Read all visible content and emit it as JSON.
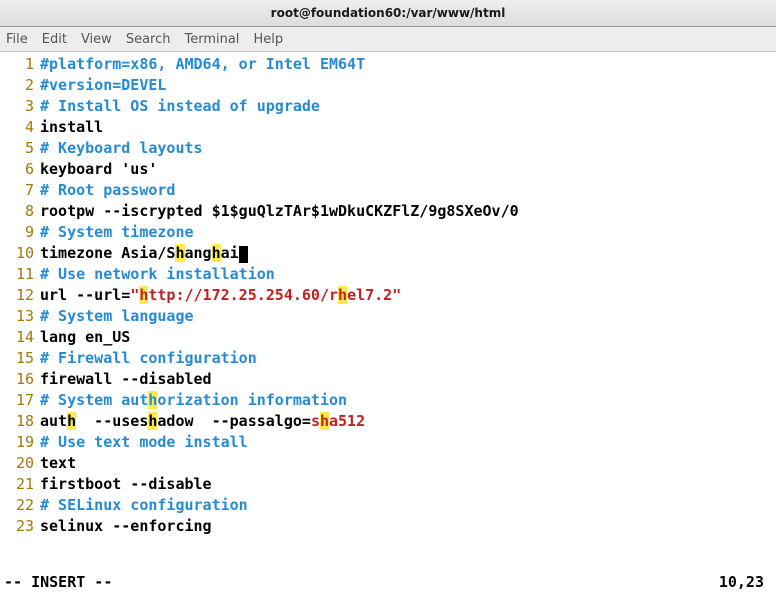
{
  "window": {
    "title": "root@foundation60:/var/www/html"
  },
  "menubar": {
    "items": [
      "File",
      "Edit",
      "View",
      "Search",
      "Terminal",
      "Help"
    ]
  },
  "editor": {
    "lines": [
      {
        "n": 1,
        "tokens": [
          {
            "t": "#platform=x86, AMD64, or Intel EM64T",
            "cls": "c-comment"
          }
        ]
      },
      {
        "n": 2,
        "tokens": [
          {
            "t": "#version=DEVEL",
            "cls": "c-comment"
          }
        ]
      },
      {
        "n": 3,
        "tokens": [
          {
            "t": "# Install OS instead of upgrade",
            "cls": "c-comment"
          }
        ]
      },
      {
        "n": 4,
        "tokens": [
          {
            "t": "install",
            "cls": "c-plain"
          }
        ]
      },
      {
        "n": 5,
        "tokens": [
          {
            "t": "# Keyboard layouts",
            "cls": "c-comment"
          }
        ]
      },
      {
        "n": 6,
        "tokens": [
          {
            "t": "keyboard 'us'",
            "cls": "c-plain"
          }
        ]
      },
      {
        "n": 7,
        "tokens": [
          {
            "t": "# Root password",
            "cls": "c-comment"
          }
        ]
      },
      {
        "n": 8,
        "tokens": [
          {
            "t": "rootpw --iscrypted $1$guQlzTAr$1wDkuCKZFlZ/9g8SXeOv/0",
            "cls": "c-plain"
          }
        ]
      },
      {
        "n": 9,
        "tokens": [
          {
            "t": "# System timezone",
            "cls": "c-comment"
          }
        ]
      },
      {
        "n": 10,
        "tokens": [
          {
            "t": "timezone Asia/S",
            "cls": "c-plain"
          },
          {
            "t": "h",
            "cls": "c-plain c-hl"
          },
          {
            "t": "ang",
            "cls": "c-plain"
          },
          {
            "t": "h",
            "cls": "c-plain c-hl"
          },
          {
            "t": "ai",
            "cls": "c-plain"
          },
          {
            "cursor": true
          }
        ]
      },
      {
        "n": 11,
        "tokens": [
          {
            "t": "# Use network installation",
            "cls": "c-comment"
          }
        ]
      },
      {
        "n": 12,
        "tokens": [
          {
            "t": "url --url=",
            "cls": "c-plain"
          },
          {
            "t": "\"",
            "cls": "c-str"
          },
          {
            "t": "h",
            "cls": "c-str c-hl"
          },
          {
            "t": "ttp://172.25.254.60/r",
            "cls": "c-str"
          },
          {
            "t": "h",
            "cls": "c-str c-hl"
          },
          {
            "t": "el7.2\"",
            "cls": "c-str"
          }
        ]
      },
      {
        "n": 13,
        "tokens": [
          {
            "t": "# System language",
            "cls": "c-comment"
          }
        ]
      },
      {
        "n": 14,
        "tokens": [
          {
            "t": "lang en_US",
            "cls": "c-plain"
          }
        ]
      },
      {
        "n": 15,
        "tokens": [
          {
            "t": "# Firewall configuration",
            "cls": "c-comment"
          }
        ]
      },
      {
        "n": 16,
        "tokens": [
          {
            "t": "firewall --disabled",
            "cls": "c-plain"
          }
        ]
      },
      {
        "n": 17,
        "tokens": [
          {
            "t": "# System aut",
            "cls": "c-comment"
          },
          {
            "t": "h",
            "cls": "c-comment c-hl"
          },
          {
            "t": "orization information",
            "cls": "c-comment"
          }
        ]
      },
      {
        "n": 18,
        "tokens": [
          {
            "t": "aut",
            "cls": "c-plain"
          },
          {
            "t": "h",
            "cls": "c-plain c-hl"
          },
          {
            "t": "  --uses",
            "cls": "c-plain"
          },
          {
            "t": "h",
            "cls": "c-plain c-hl"
          },
          {
            "t": "adow  --passalgo=",
            "cls": "c-plain"
          },
          {
            "t": "s",
            "cls": "c-str"
          },
          {
            "t": "h",
            "cls": "c-str c-hl"
          },
          {
            "t": "a512",
            "cls": "c-str"
          }
        ]
      },
      {
        "n": 19,
        "tokens": [
          {
            "t": "# Use text mode install",
            "cls": "c-comment"
          }
        ]
      },
      {
        "n": 20,
        "tokens": [
          {
            "t": "text",
            "cls": "c-plain"
          }
        ]
      },
      {
        "n": 21,
        "tokens": [
          {
            "t": "firstboot --disable",
            "cls": "c-plain"
          }
        ]
      },
      {
        "n": 22,
        "tokens": [
          {
            "t": "# SELinux configuration",
            "cls": "c-comment"
          }
        ]
      },
      {
        "n": 23,
        "tokens": [
          {
            "t": "selinux --enforcing",
            "cls": "c-plain"
          }
        ]
      }
    ]
  },
  "status": {
    "mode": "-- INSERT --",
    "position": "10,23"
  }
}
